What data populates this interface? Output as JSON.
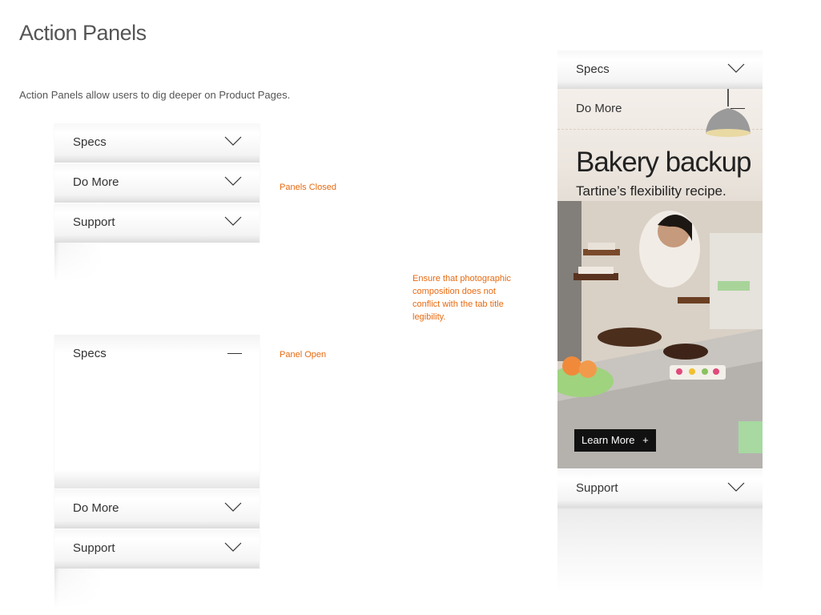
{
  "page": {
    "title": "Action Panels",
    "subtitle": "Action Panels allow users to dig deeper on Product Pages."
  },
  "notes": {
    "closed": "Panels Closed",
    "open": "Panel Open",
    "photo_line1": "Ensure that photographic",
    "photo_line2": "composition does not",
    "photo_line3": "conflict with the tab title",
    "photo_line4": "legibility."
  },
  "closed_panels": {
    "specs": "Specs",
    "do_more": "Do More",
    "support": "Support"
  },
  "open_panels": {
    "specs": "Specs",
    "do_more": "Do More",
    "support": "Support"
  },
  "phone": {
    "specs": "Specs",
    "do_more": "Do More",
    "hero_title": "Bakery backup",
    "hero_subtitle": "Tartine’s flexibility recipe.",
    "cta_label": "Learn More",
    "cta_icon": "+",
    "support": "Support"
  },
  "colors": {
    "annotation": "#e86a10",
    "cta_background": "#111111"
  }
}
